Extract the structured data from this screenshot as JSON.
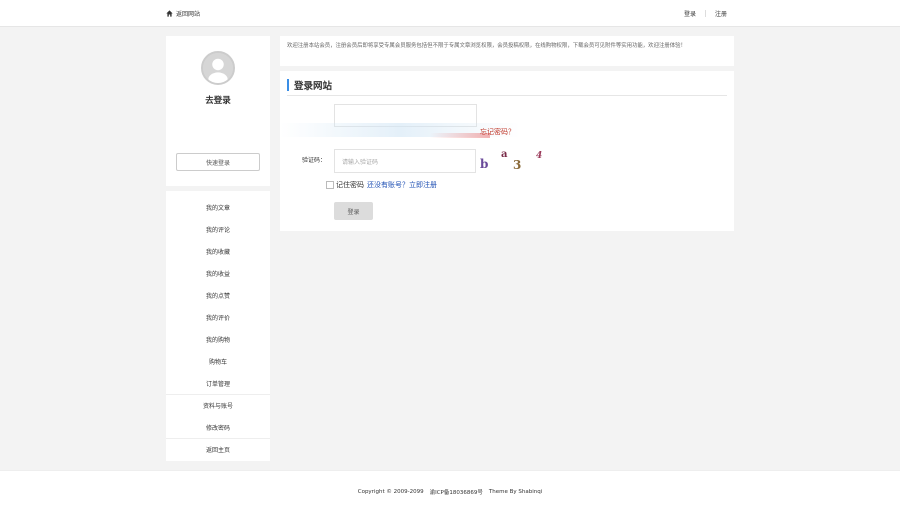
{
  "topbar": {
    "home_label": "返回网站",
    "login_label": "登录",
    "register_label": "注册"
  },
  "sidebar": {
    "login_title": "去登录",
    "quick_login_label": "快速登录",
    "menu": [
      "我的文章",
      "我的评论",
      "我的收藏",
      "我的收益",
      "我的点赞",
      "我的评价",
      "我的购物",
      "购物车",
      "订单管理",
      "资料与账号",
      "修改密码",
      "返回主页"
    ]
  },
  "notice": {
    "text": "欢迎注册本站会员，注册会员后即将享受专属会员服务包括但不限于专属文章浏览权限，会员投稿权限，在线购物权限，下载会员可见附件等实用功能，欢迎注册体验！"
  },
  "login_form": {
    "title": "登录网站",
    "forgot_label": "忘记密码？",
    "captcha_label": "验证码：",
    "captcha_placeholder": "请输入验证码",
    "captcha_chars": [
      "b",
      "a",
      "3",
      "4"
    ],
    "remember_label": "记住密码",
    "no_account_label": "还没有账号？立即注册",
    "submit_label": "登录"
  },
  "footer": {
    "copyright": "Copyright © 2009-2099",
    "icp": "渝ICP备18036869号",
    "theme": "Theme By Shabinqi"
  },
  "colors": {
    "accent": "#3a8ee6",
    "link": "#1e4fb3",
    "error": "#c0392b"
  }
}
